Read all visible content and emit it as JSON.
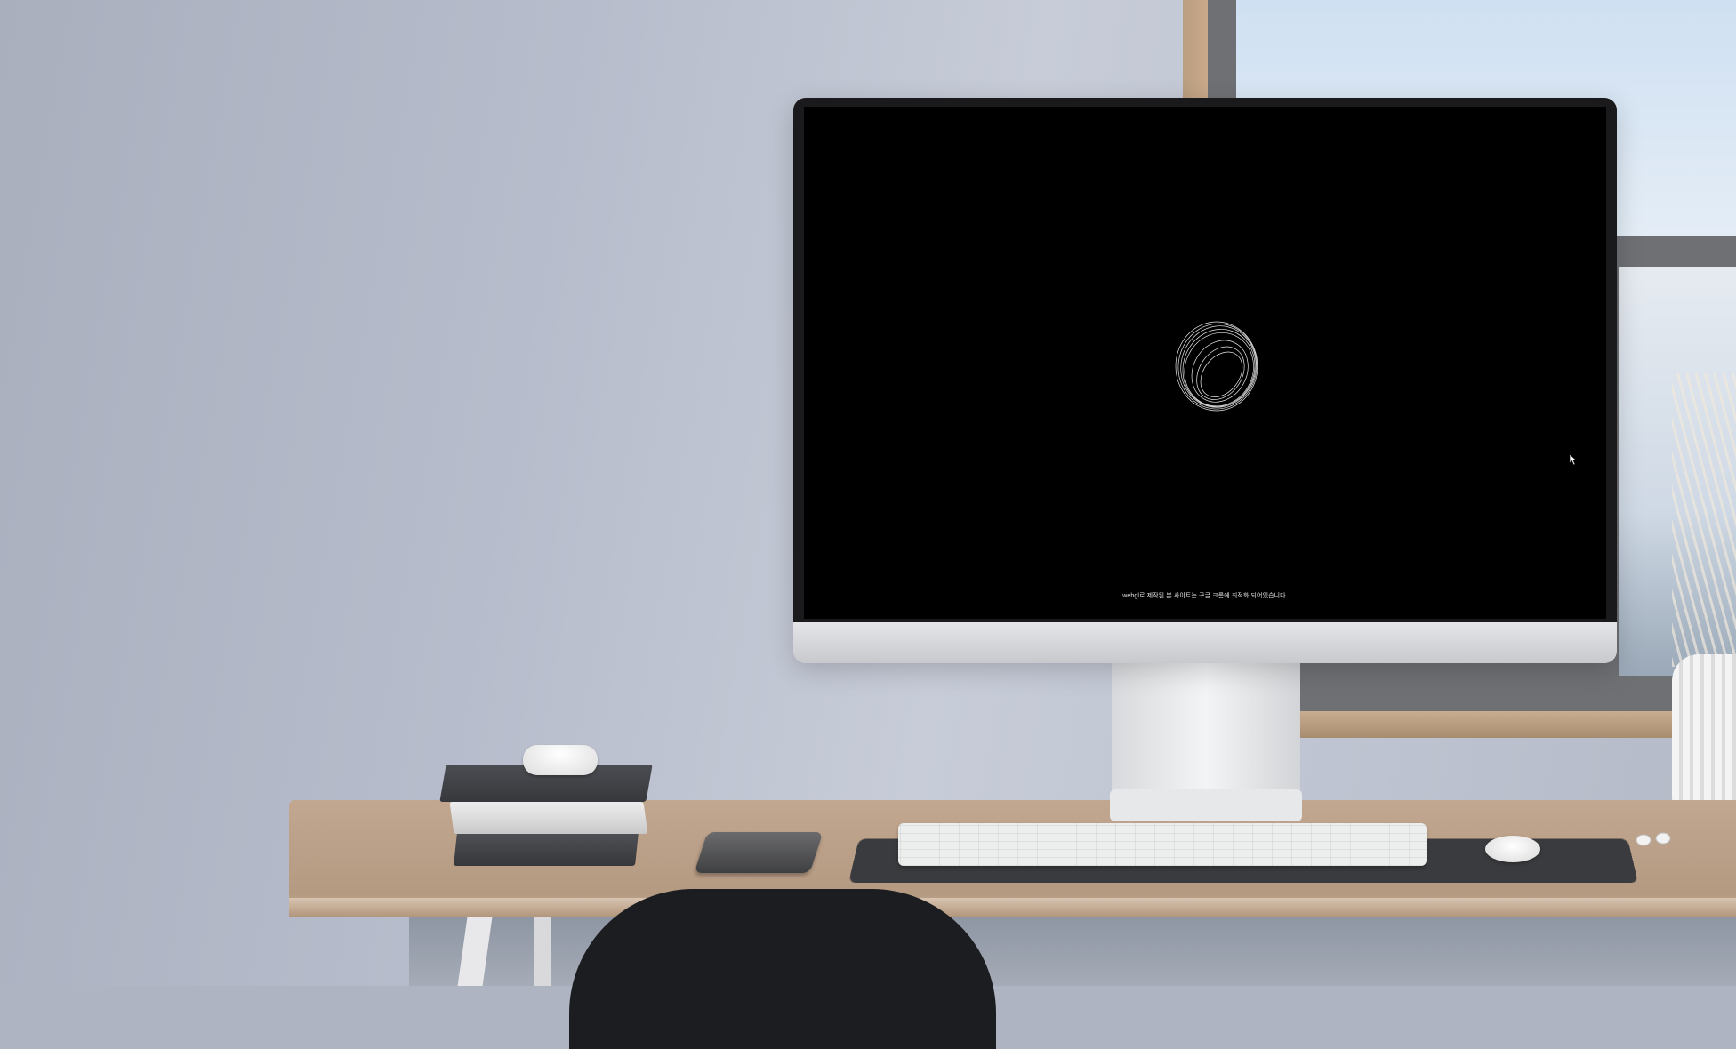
{
  "screen": {
    "loader_icon": "spinning-ring-icon",
    "notice_text": "webgl로 제작된 본 사이트는 구글 크롬에 최적화 되어있습니다.",
    "cursor_icon": "mouse-pointer-icon",
    "background_color": "#000000"
  },
  "scene": {
    "objects": [
      "monitor",
      "keyboard",
      "mouse",
      "smartphone",
      "books",
      "airpods-case",
      "airpods",
      "desk",
      "chair",
      "window",
      "vase"
    ]
  }
}
